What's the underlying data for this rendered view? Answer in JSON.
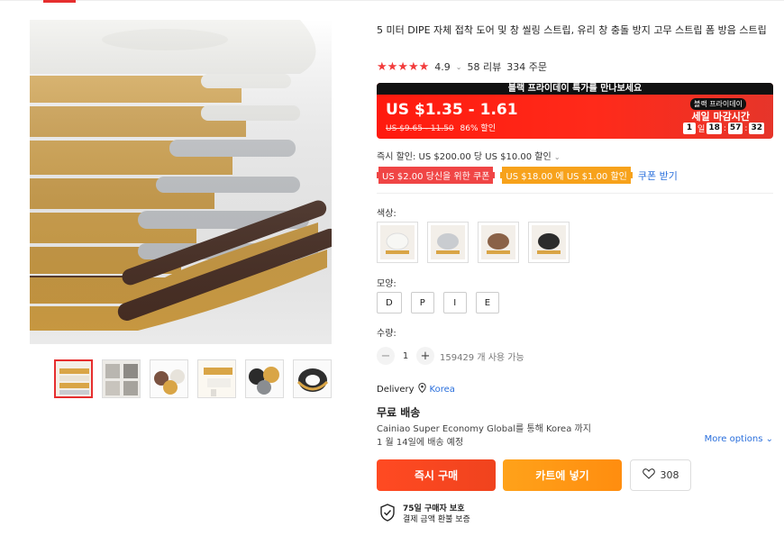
{
  "product": {
    "title": "5 미터 DIPE 자체 접착 도어 및 창 씰링 스트립, 유리 창 충돌 방지 고무 스트립 폼 방음 스트립",
    "rating": "4.9",
    "reviews": "58 리뷰",
    "orders": "334 주문"
  },
  "promo": {
    "banner": "블랙 프라이데이 특가를 만나보세요",
    "price": "US $1.35 - 1.61",
    "old_price": "US $9.65 - 11.50",
    "discount": "86% 할인",
    "badge": "블랙 프라이데이",
    "ends_label": "세일 마감시간",
    "days": "1",
    "days_unit": "일",
    "hours": "18",
    "minutes": "57",
    "seconds": "32"
  },
  "discounts": {
    "instant": "즉시 할인: US $200.00 당 US $10.00 할인",
    "coupon1": "US $2.00 당신을 위한 쿠폰",
    "coupon2": "US $18.00 에 US $1.00 할인",
    "get_coupons": "쿠폰 받기"
  },
  "options": {
    "color_label": "색상:",
    "shape_label": "모양:",
    "shapes": [
      "D",
      "P",
      "I",
      "E"
    ],
    "qty_label": "수량:",
    "qty_value": "1",
    "qty_minus": "−",
    "qty_plus": "+",
    "available": "159429 개 사용 가능"
  },
  "delivery": {
    "label": "Delivery",
    "location": "Korea",
    "free_shipping": "무료 배송",
    "carrier": "Cainiao Super Economy Global를 통해 Korea 까지",
    "eta": "1 월 14일에 배송 예정",
    "more_options": "More options"
  },
  "actions": {
    "buy_now": "즉시 구매",
    "add_to_cart": "카트에 넣기",
    "wishlist_count": "308"
  },
  "protection": {
    "title": "75일 구매자 보호",
    "subtitle": "결제 금액 환불 보증"
  },
  "colors": {
    "accent": "#e62e2e",
    "tape_yellow": "#d9a546",
    "tape_white": "#f2f2ee",
    "tape_gray": "#c9ccd0",
    "tape_brown": "#4a2f24"
  }
}
